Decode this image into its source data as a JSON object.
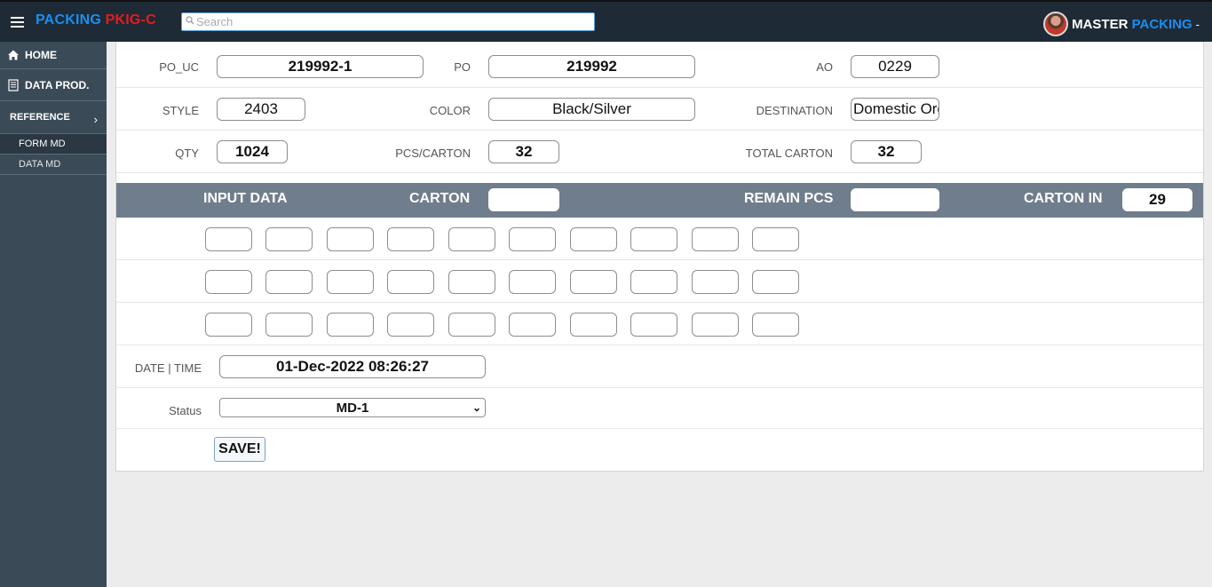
{
  "header": {
    "brand_part1": "PACKING ",
    "brand_part2": "PKIG-C",
    "search_placeholder": "Search",
    "search_value": "",
    "user_part1": "MASTER ",
    "user_part2": "PACKING",
    "user_caret": "-"
  },
  "sidebar": {
    "home": "HOME",
    "data_prod": "DATA PROD.",
    "reference": "REFERENCE",
    "reference_chevron": "›",
    "sub_items": [
      "FORM MD",
      "DATA MD"
    ]
  },
  "form": {
    "po_uc_label": "PO_UC",
    "po_uc_value": "219992-1",
    "po_label": "PO",
    "po_value": "219992",
    "ao_label": "AO",
    "ao_value": "0229",
    "style_label": "STYLE",
    "style_value": "2403",
    "color_label": "COLOR",
    "color_value": "Black/Silver",
    "destination_label": "DESTINATION",
    "destination_value": "Domestic Order",
    "qty_label": "QTY",
    "qty_value": "1024",
    "pcs_carton_label": "PCS/CARTON",
    "pcs_carton_value": "32",
    "total_carton_label": "TOTAL CARTON",
    "total_carton_value": "32"
  },
  "input_bar": {
    "input_data_label": "INPUT DATA",
    "carton_label": "CARTON",
    "carton_value": "",
    "remain_pcs_label": "REMAIN PCS",
    "remain_pcs_value": "",
    "carton_in_label": "CARTON IN",
    "carton_in_value": "29"
  },
  "footer_form": {
    "datetime_label": "DATE | TIME",
    "datetime_value": "01-Dec-2022 08:26:27",
    "status_label": "Status",
    "status_selected": "MD-1",
    "save_label": "SAVE!"
  },
  "colors": {
    "topbar": "#1e2a35",
    "sidebar": "#3b4a57",
    "brand_blue": "#1b8ef0",
    "brand_red": "#e51c1c",
    "input_bar": "#6f7d8c"
  }
}
